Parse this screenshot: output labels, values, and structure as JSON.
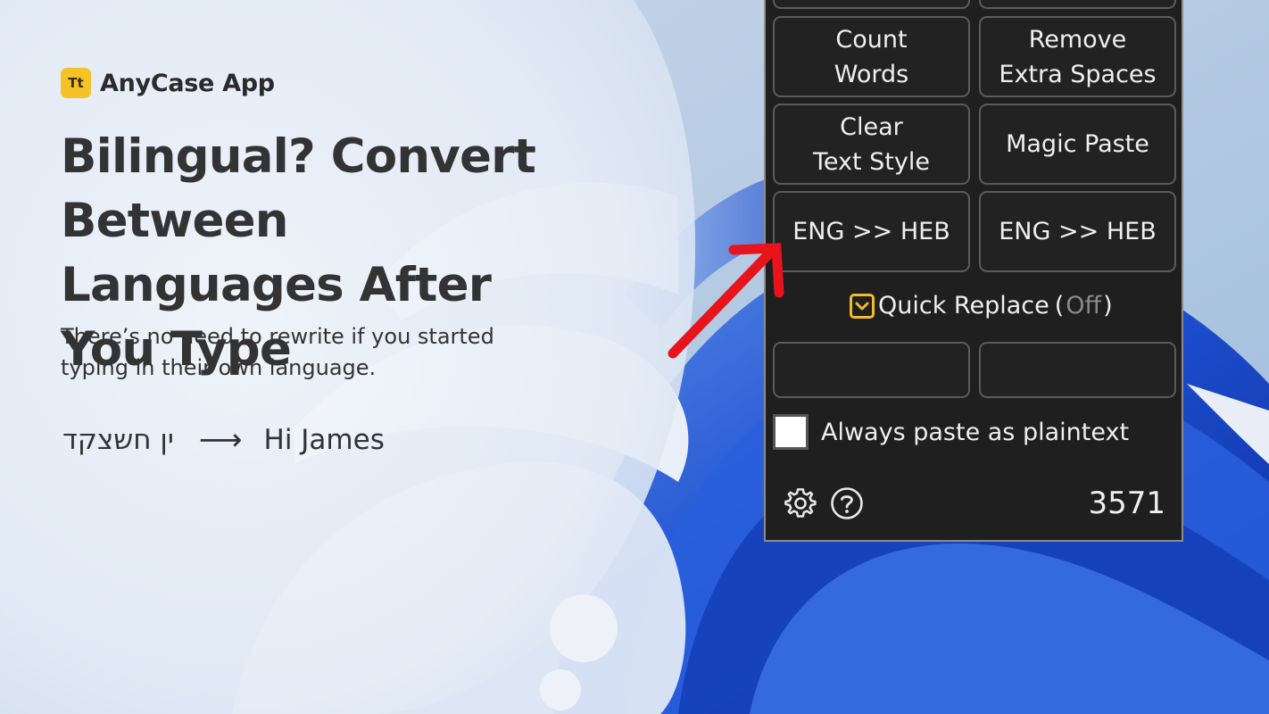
{
  "brand": {
    "logo_text": "Tt",
    "name": "AnyCase App",
    "logo_color": "#f6c327"
  },
  "headline": "Bilingual? Convert Between Languages After You Type",
  "subtext": "There’s no need to rewrite if you started typing in their own language.",
  "example": {
    "source": "ין חשצקד",
    "target": "Hi James"
  },
  "panel": {
    "buttons": {
      "count_words": "Count\nWords",
      "remove_spaces": "Remove\nExtra Spaces",
      "clear_style": "Clear\nText Style",
      "magic_paste": "Magic Paste",
      "eng_heb_1": "ENG >> HEB",
      "eng_heb_2": "ENG >> HEB",
      "blank_1": "",
      "blank_2": ""
    },
    "quick_replace": {
      "label": "Quick Replace",
      "open_paren": "(",
      "state": "Off",
      "close_paren": ")"
    },
    "plaintext_label": "Always paste as plaintext",
    "plaintext_checked": false,
    "icons": [
      "gear-icon",
      "help-icon"
    ],
    "counter": "3571"
  },
  "colors": {
    "accent": "#f5b92c",
    "panel_bg": "#1f1f1f",
    "annotation_arrow": "#e8141c"
  }
}
